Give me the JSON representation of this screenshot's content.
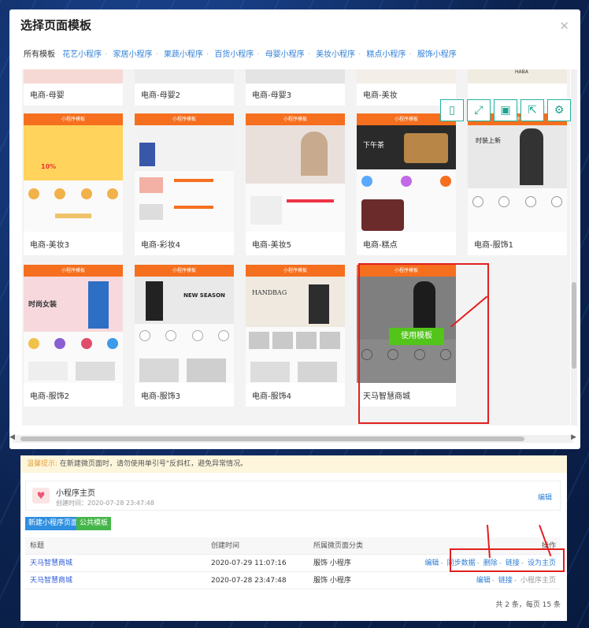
{
  "modal": {
    "title": "选择页面模板",
    "close_icon": "close-icon",
    "categories_all": "所有模板",
    "categories": [
      "花艺小程序",
      "家居小程序",
      "果蔬小程序",
      "百货小程序",
      "母婴小程序",
      "美妆小程序",
      "糕点小程序",
      "服饰小程序"
    ],
    "toolbar_icons": [
      "tablet-icon",
      "expand-icon",
      "save-icon",
      "share-icon",
      "gear-icon"
    ],
    "toolbar_glyphs": [
      "▯",
      "⤢",
      "▣",
      "⇱",
      "⚙"
    ],
    "phone_header": "小程序模板",
    "top_row": [
      "电商-母婴",
      "电商-母婴2",
      "电商-母婴3",
      "电商-美妆",
      ""
    ],
    "top_row_partial_text": "HABA",
    "row2": [
      "电商-美妆3",
      "电商-彩妆4",
      "电商-美妆5",
      "电商-糕点",
      "电商-服饰1"
    ],
    "row3": [
      "电商-服饰2",
      "电商-服饰3",
      "电商-服饰4",
      "天马智慧商城"
    ],
    "use_template_label": "使用模板",
    "card_texts": {
      "beauty_discount": "10%",
      "bakery_slogan": "下午茶",
      "fashion_sale": "时尚女装",
      "new_season": "NEW SEASON",
      "handbag": "HANDBAG",
      "new_arrival": "时装上新"
    }
  },
  "page": {
    "tip_label": "温馨提示:",
    "tip_text": "在新建微页面时，请勿使用单引号\"反斜杠，避免异常情况。",
    "home": {
      "title": "小程序主页",
      "created": "创建时间：2020-07-28 23:47:48",
      "edit": "编辑"
    },
    "buttons": {
      "new_page": "新建小程序页面",
      "public_template": "公共模板"
    },
    "table": {
      "headers": [
        "标题",
        "创建时间",
        "所属微页面分类",
        "操作"
      ],
      "rows": [
        {
          "title": "天马智慧商城",
          "created": "2020-07-29 11:07:16",
          "category": "服饰 小程序",
          "ops": [
            "编辑",
            "同步数据",
            "删除",
            "链接",
            "设为主页"
          ]
        },
        {
          "title": "天马智慧商城",
          "created": "2020-07-28 23:47:48",
          "category": "服饰 小程序",
          "ops": [
            "编辑",
            "链接"
          ],
          "ops_plain": "小程序主页"
        }
      ]
    },
    "pager": "共 2 条，每页 15 条"
  }
}
